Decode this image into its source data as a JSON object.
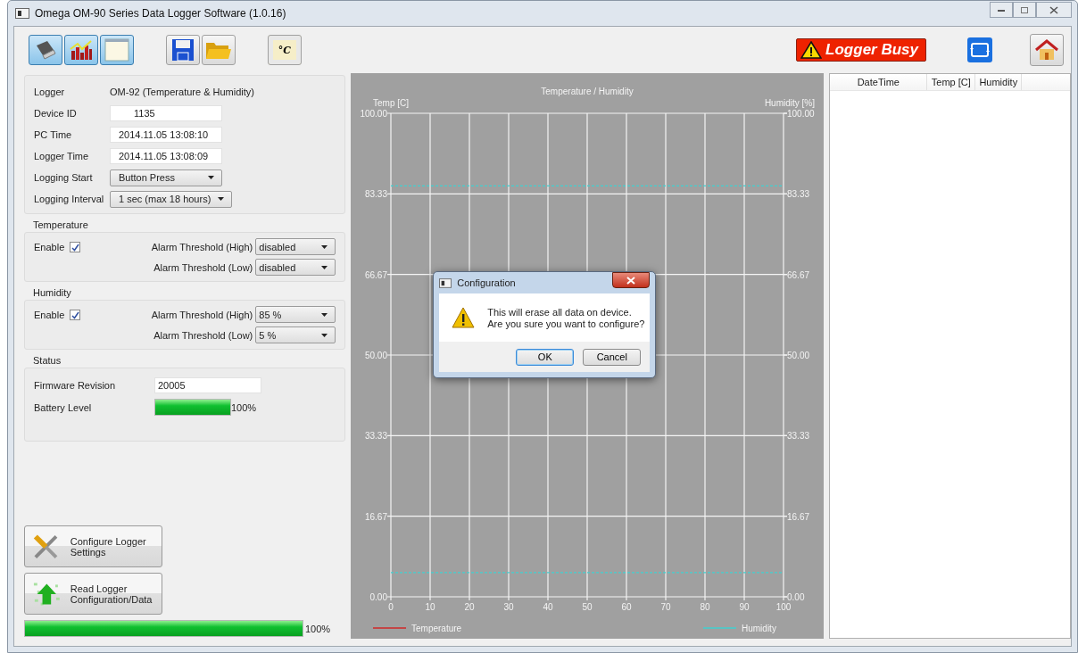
{
  "window": {
    "title": "Omega OM-90 Series Data Logger Software (1.0.16)"
  },
  "toolbar": {
    "unit_button": "°C",
    "status_badge": "Logger Busy"
  },
  "device": {
    "rows": [
      {
        "label": "Logger",
        "kind": "text",
        "value": "OM-92 (Temperature & Humidity)"
      },
      {
        "label": "Device ID",
        "kind": "field",
        "value": "1135"
      },
      {
        "label": "PC Time",
        "kind": "field",
        "value": "2014.11.05 13:08:10"
      },
      {
        "label": "Logger Time",
        "kind": "field",
        "value": "2014.11.05 13:08:09"
      },
      {
        "label": "Logging Start",
        "kind": "dropdown",
        "value": "Button Press"
      },
      {
        "label": "Logging Interval",
        "kind": "dropdown",
        "value": "1 sec (max 18 hours)"
      }
    ]
  },
  "groups": [
    {
      "title": "Temperature",
      "enable_label": "Enable",
      "checked": true,
      "thresholds": [
        {
          "label": "Alarm Threshold (High)",
          "value": "disabled"
        },
        {
          "label": "Alarm Threshold (Low)",
          "value": "disabled"
        }
      ]
    },
    {
      "title": "Humidity",
      "enable_label": "Enable",
      "checked": true,
      "thresholds": [
        {
          "label": "Alarm Threshold (High)",
          "value": "85 %"
        },
        {
          "label": "Alarm Threshold (Low)",
          "value": "5 %"
        }
      ]
    }
  ],
  "status": {
    "title": "Status",
    "firmware_label": "Firmware Revision",
    "firmware": "20005",
    "battery_label": "Battery Level",
    "battery": {
      "level": 1,
      "reading": "100%"
    }
  },
  "actions": [
    {
      "kind": "configure",
      "label": "Configure Logger Settings"
    },
    {
      "kind": "read",
      "label": "Read Logger Configuration/Data"
    }
  ],
  "progress": {
    "level": 1,
    "reading": "100%"
  },
  "chart": {
    "right_axis_label": "Humidity [%]",
    "chart_data": {
      "type": "line",
      "title": "Temperature / Humidity",
      "ylabel": "Temp [C]",
      "grid": true,
      "x": [
        0,
        100
      ],
      "xlim": [
        0,
        100
      ],
      "ylim": [
        0,
        100
      ],
      "xticks": [
        0,
        10,
        20,
        30,
        40,
        50,
        60,
        70,
        80,
        90,
        100
      ],
      "yticks": [
        {
          "value": 0,
          "label": "0.00"
        },
        {
          "value": 16.67,
          "label": "16.67"
        },
        {
          "value": 33.33,
          "label": "33.33"
        },
        {
          "value": 50,
          "label": "50.00"
        },
        {
          "value": 66.67,
          "label": "66.67"
        },
        {
          "value": 83.33,
          "label": "83.33"
        },
        {
          "value": 100,
          "label": "100.00"
        }
      ],
      "series": [
        {
          "name": "Temperature",
          "color": "#d02828",
          "values": [
            null,
            null
          ]
        },
        {
          "name": "Humidity",
          "color": "#40d0d0",
          "values": [
            null,
            null
          ]
        },
        {
          "color": "#40d0d0",
          "line_style": "dashed",
          "values": [
            85,
            85
          ]
        },
        {
          "color": "#40d0d0",
          "line_style": "dashed",
          "values": [
            5,
            5
          ]
        }
      ]
    }
  },
  "table": {
    "columns": [
      "DateTime",
      "Temp [C]",
      "Humidity"
    ]
  },
  "dialog": {
    "title": "Configuration",
    "message": [
      "This will erase all data on device.",
      "Are you sure you want to configure?"
    ],
    "buttons": [
      {
        "label": "OK",
        "selected": true
      },
      {
        "label": "Cancel",
        "selected": false
      }
    ]
  }
}
